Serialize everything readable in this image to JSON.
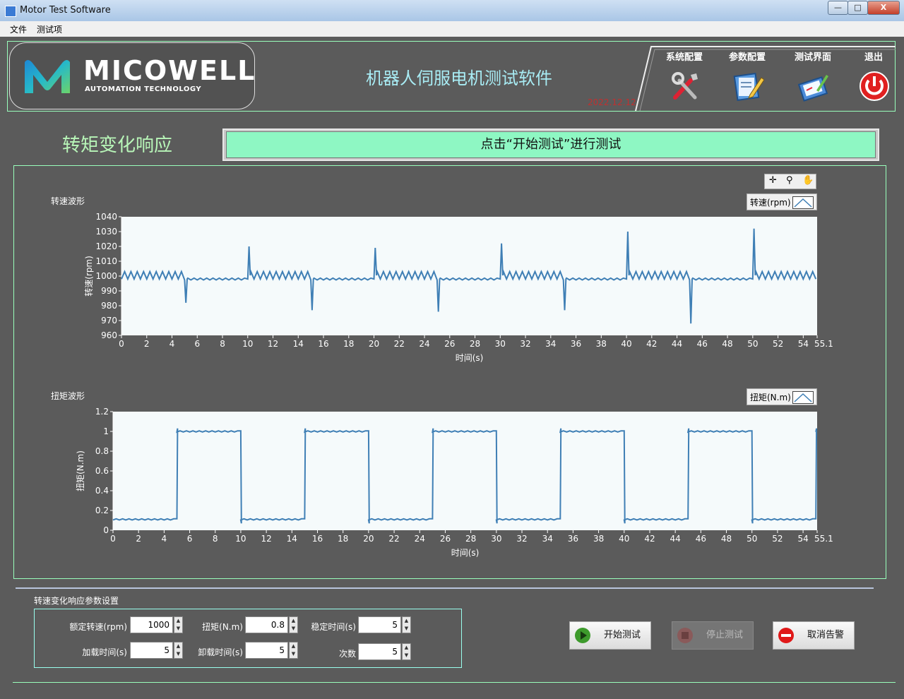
{
  "window": {
    "title": "Motor Test Software",
    "minimize": "—",
    "maximize": "□",
    "close": "X"
  },
  "menu": {
    "items": [
      "文件",
      "测试项"
    ]
  },
  "header": {
    "logo_text": "MICOWELL",
    "logo_sub": "AUTOMATION TECHNOLOGY",
    "app_title": "机器人伺服电机测试软件",
    "date": "2022.12.12",
    "nav": [
      {
        "label": "系统配置",
        "icon": "tools-icon"
      },
      {
        "label": "参数配置",
        "icon": "edit-form-icon"
      },
      {
        "label": "测试界面",
        "icon": "test-clipboard-icon"
      },
      {
        "label": "退出",
        "icon": "power-icon"
      }
    ]
  },
  "section_title": "转矩变化响应",
  "status_message": "点击“开始测试”进行测试",
  "speed_graph": {
    "label": "转速波形",
    "legend": "转速(rpm)"
  },
  "torque_graph": {
    "label": "扭矩波形",
    "legend": "扭矩(N.m)"
  },
  "graph_tools": {
    "cursor": "✛",
    "zoom": "⚲",
    "pan": "✋"
  },
  "chart_data": [
    {
      "type": "line",
      "title": "转速波形",
      "xlabel": "时间(s)",
      "ylabel": "转速(rpm)",
      "xlim": [
        0,
        55.1
      ],
      "ylim": [
        960,
        1040
      ],
      "xticks": [
        0,
        2,
        4,
        6,
        8,
        10,
        12,
        14,
        16,
        18,
        20,
        22,
        24,
        26,
        28,
        30,
        32,
        34,
        36,
        38,
        40,
        42,
        44,
        46,
        48,
        50,
        52,
        54,
        55.1
      ],
      "xtick_labels": [
        "0",
        "2",
        "4",
        "6",
        "8",
        "10",
        "12",
        "14",
        "16",
        "18",
        "20",
        "22",
        "24",
        "26",
        "28",
        "30",
        "32",
        "34",
        "36",
        "38",
        "40",
        "42",
        "44",
        "46",
        "48",
        "50",
        "52",
        "54",
        "55.1"
      ],
      "yticks": [
        960,
        970,
        980,
        990,
        1000,
        1010,
        1020,
        1030,
        1040
      ],
      "series": [
        {
          "name": "转速(rpm)",
          "color": "#3f7fb5",
          "load_levels": {
            "high": 1000.5,
            "low": 998
          },
          "ripple": {
            "high": 2.5,
            "low": 0.6
          },
          "segments_high": [
            [
              0,
              5
            ],
            [
              10,
              15
            ],
            [
              20,
              25
            ],
            [
              30,
              35
            ],
            [
              40,
              45
            ],
            [
              50,
              55.1
            ]
          ],
          "dips": [
            {
              "x": 5.1,
              "y": 982
            },
            {
              "x": 15.1,
              "y": 977
            },
            {
              "x": 25.1,
              "y": 976
            },
            {
              "x": 35.1,
              "y": 977
            },
            {
              "x": 45.1,
              "y": 968
            }
          ],
          "peaks": [
            {
              "x": 10.1,
              "y": 1020
            },
            {
              "x": 20.1,
              "y": 1019
            },
            {
              "x": 30.1,
              "y": 1022
            },
            {
              "x": 40.1,
              "y": 1030
            },
            {
              "x": 50.1,
              "y": 1032
            }
          ]
        }
      ]
    },
    {
      "type": "line",
      "title": "扭矩波形",
      "xlabel": "时间(s)",
      "ylabel": "扭矩(N.m)",
      "xlim": [
        0,
        55.1
      ],
      "ylim": [
        0,
        1.2
      ],
      "xticks": [
        0,
        2,
        4,
        6,
        8,
        10,
        12,
        14,
        16,
        18,
        20,
        22,
        24,
        26,
        28,
        30,
        32,
        34,
        36,
        38,
        40,
        42,
        44,
        46,
        48,
        50,
        52,
        54,
        55.1
      ],
      "xtick_labels": [
        "0",
        "2",
        "4",
        "6",
        "8",
        "10",
        "12",
        "14",
        "16",
        "18",
        "20",
        "22",
        "24",
        "26",
        "28",
        "30",
        "32",
        "34",
        "36",
        "38",
        "40",
        "42",
        "44",
        "46",
        "48",
        "50",
        "52",
        "54",
        "55.1"
      ],
      "yticks": [
        0,
        0.2,
        0.4,
        0.6,
        0.8,
        1,
        1.2
      ],
      "ytick_labels": [
        "0",
        "0.2",
        "0.4",
        "0.6",
        "0.8",
        "1",
        "1.2"
      ],
      "series": [
        {
          "name": "扭矩(N.m)",
          "color": "#3f7fb5",
          "square_wave": {
            "low": 0.11,
            "high": 1.0,
            "period": 10,
            "high_start": 5,
            "high_duration": 5
          },
          "end": 55.1
        }
      ]
    }
  ],
  "params": {
    "title": "转速变化响应参数设置",
    "rated_speed_label": "额定转速(rpm)",
    "rated_speed": "1000",
    "torque_label": "扭矩(N.m)",
    "torque": "0.8",
    "settle_label": "稳定时间(s)",
    "settle": "5",
    "load_label": "加载时间(s)",
    "load": "5",
    "unload_label": "卸载时间(s)",
    "unload": "5",
    "count_label": "次数",
    "count": "5",
    "spin_up": "▲",
    "spin_down": "▼"
  },
  "actions": {
    "start": "开始测试",
    "stop": "停止测试",
    "cancel": "取消告警"
  }
}
